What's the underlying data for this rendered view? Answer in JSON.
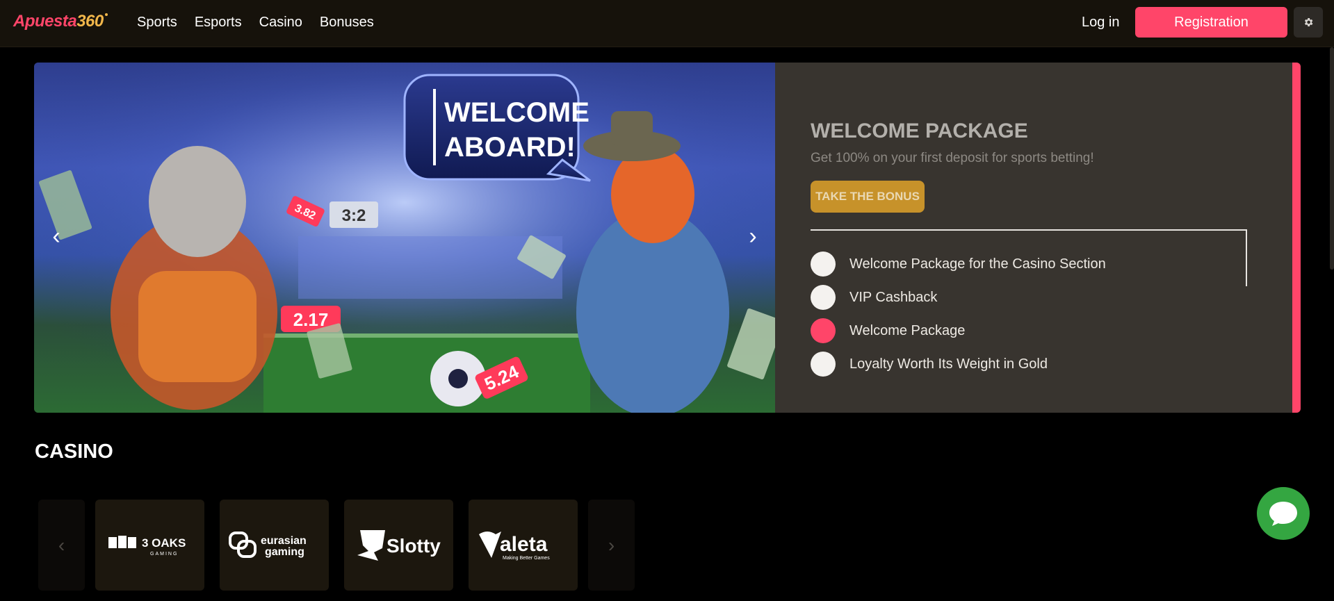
{
  "header": {
    "logo_part1": "Apuesta",
    "logo_part2": "360",
    "nav": [
      "Sports",
      "Esports",
      "Casino",
      "Bonuses"
    ],
    "login": "Log in",
    "register": "Registration",
    "settings_icon": "gear-icon"
  },
  "banner": {
    "speech_line1": "WELCOME",
    "speech_line2": "ABOARD!",
    "score": "3:2",
    "odd1": "3.82",
    "odd2": "2.17",
    "odd3": "5.24",
    "title": "WELCOME PACKAGE",
    "subtitle": "Get 100% on your first deposit for sports betting!",
    "cta": "TAKE THE BONUS",
    "offers": [
      {
        "label": "Welcome Package for the Casino Section",
        "active": false
      },
      {
        "label": "VIP Cashback",
        "active": false
      },
      {
        "label": "Welcome Package",
        "active": true
      },
      {
        "label": "Loyalty Worth Its Weight in Gold",
        "active": false
      }
    ],
    "accent_color": "#ff4569"
  },
  "casino": {
    "title": "CASINO",
    "providers": [
      {
        "name": "3 OAKS",
        "sub": "GAMING"
      },
      {
        "name": "eurasian",
        "sub": "gaming"
      },
      {
        "name": "Slotty",
        "sub": ""
      },
      {
        "name": "aleta",
        "sub": "Making Better Games"
      }
    ]
  },
  "chat_icon": "chat-bubble-icon"
}
